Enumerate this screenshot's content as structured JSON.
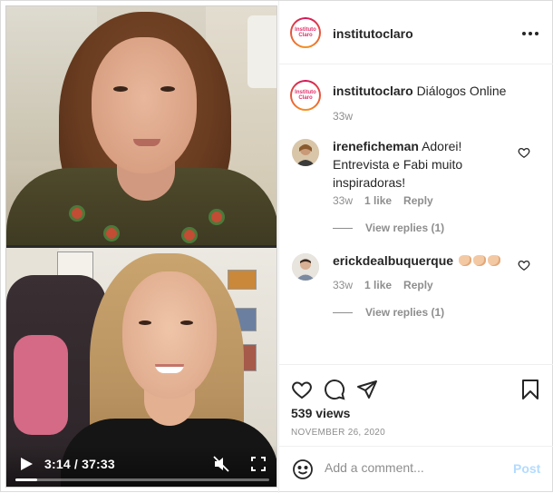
{
  "video": {
    "time_display": "3:14 / 37:33",
    "progress_fraction": 0.086
  },
  "post": {
    "username": "institutoclaro",
    "avatar_text": "Instituto Claro",
    "caption_username": "institutoclaro",
    "caption_text": "Diálogos Online",
    "caption_time": "33w",
    "views": "539 views",
    "date": "NOVEMBER 26, 2020"
  },
  "comments": [
    {
      "username": "ireneficheman",
      "text": "Adorei! Entrevista e Fabi muito inspiradoras!",
      "time": "33w",
      "likes": "1 like",
      "reply_label": "Reply",
      "view_replies": "View replies (1)"
    },
    {
      "username": "erickdealbuquerque",
      "text": "",
      "time": "33w",
      "likes": "1 like",
      "reply_label": "Reply",
      "view_replies": "View replies (1)"
    }
  ],
  "comment_box": {
    "placeholder": "Add a comment...",
    "post_label": "Post"
  },
  "colors": {
    "brand_ring": "#d4145a",
    "link_disabled": "#b3dbff",
    "muted_text": "#8e8e8e"
  }
}
